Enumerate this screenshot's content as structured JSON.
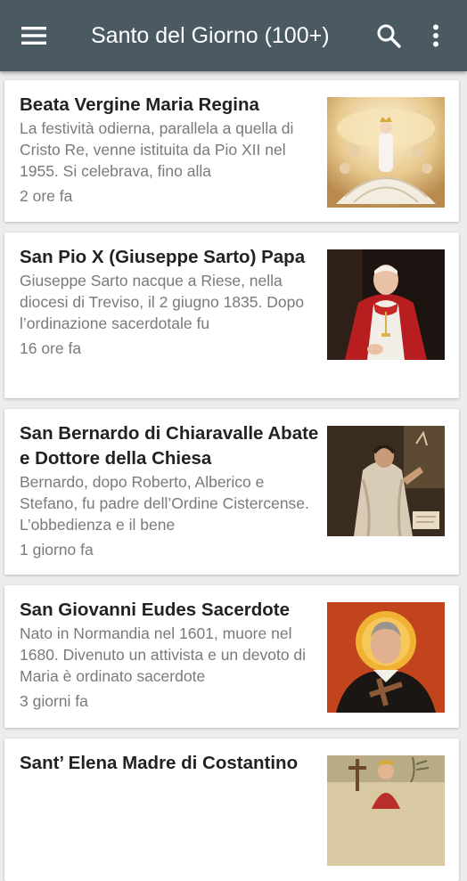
{
  "appbar": {
    "title": "Santo del Giorno (100+)",
    "menu_icon": "hamburger-menu-icon",
    "search_icon": "search-icon",
    "overflow_icon": "more-vert-icon",
    "color": "#4b5a62"
  },
  "items": [
    {
      "title": "Beata Vergine Maria Regina",
      "excerpt": "La festività odierna, parallela a quella di Cristo Re, venne istituita da Pio XII nel 1955. Si celebrava, fino alla",
      "time": "2 ore fa"
    },
    {
      "title": "San Pio X (Giuseppe Sarto) Papa",
      "excerpt": "Giuseppe Sarto nacque a Riese, nella diocesi di Treviso, il 2 giugno 1835. Dopo l’ordinazione sacerdotale fu",
      "time": "16 ore fa"
    },
    {
      "title": "San Bernardo di Chiaravalle Abate e Dottore della Chiesa",
      "excerpt": "Bernardo, dopo Roberto, Alberico e Stefano, fu padre dell’Ordine Cistercense. L’obbedienza e il bene",
      "time": "1 giorno fa"
    },
    {
      "title": "San Giovanni Eudes Sacerdote",
      "excerpt": "Nato in Normandia nel 1601, muore nel 1680. Divenuto un attivista e un devoto di Maria è ordinato sacerdote",
      "time": "3 giorni fa"
    },
    {
      "title": "Sant’ Elena Madre di Costantino",
      "excerpt": "",
      "time": ""
    }
  ]
}
